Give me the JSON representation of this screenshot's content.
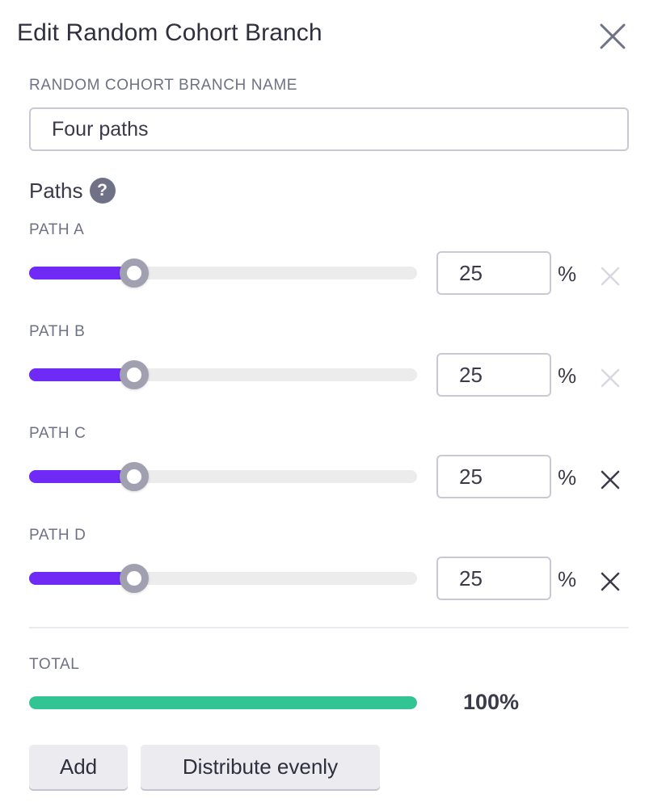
{
  "dialog": {
    "title": "Edit Random Cohort Branch",
    "close_icon": "close-icon"
  },
  "branch_name": {
    "label": "RANDOM COHORT BRANCH NAME",
    "value": "Four paths"
  },
  "paths": {
    "heading": "Paths",
    "help_icon": "?",
    "unit": "%",
    "items": [
      {
        "label": "PATH A",
        "value": "25",
        "percent": 25,
        "removable": false
      },
      {
        "label": "PATH B",
        "value": "25",
        "percent": 25,
        "removable": false
      },
      {
        "label": "PATH C",
        "value": "25",
        "percent": 25,
        "removable": true
      },
      {
        "label": "PATH D",
        "value": "25",
        "percent": 25,
        "removable": true
      }
    ]
  },
  "total": {
    "label": "TOTAL",
    "value": "100%",
    "percent": 100
  },
  "actions": {
    "add_label": "Add",
    "distribute_label": "Distribute evenly"
  },
  "colors": {
    "slider_fill": "#6f2bf5",
    "total_fill": "#33c494",
    "remove_enabled": "#3a3a4a",
    "remove_disabled": "#d8d8e0"
  }
}
